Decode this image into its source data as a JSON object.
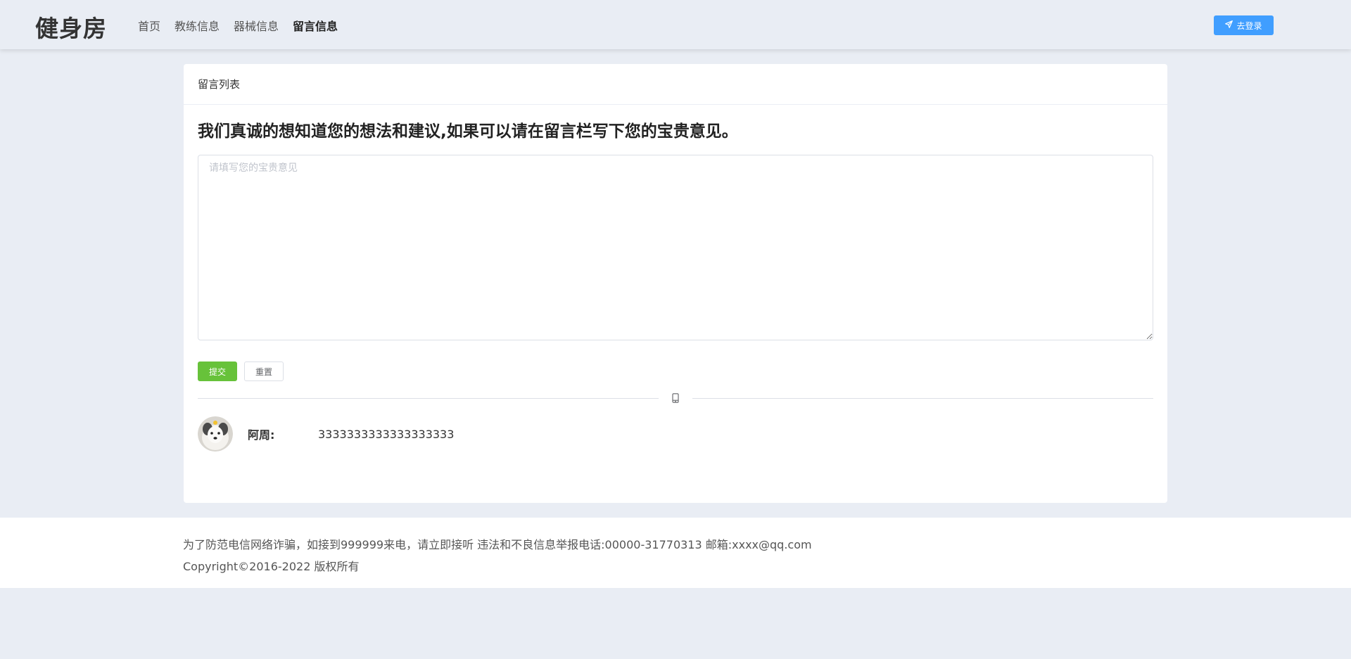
{
  "header": {
    "logo": "健身房",
    "nav": [
      {
        "label": "首页",
        "active": false
      },
      {
        "label": "教练信息",
        "active": false
      },
      {
        "label": "器械信息",
        "active": false
      },
      {
        "label": "留言信息",
        "active": true
      }
    ],
    "login_label": "去登录"
  },
  "card": {
    "title": "留言列表",
    "headline": "我们真诚的想知道您的想法和建议,如果可以请在留言栏写下您的宝贵意见。",
    "textarea": {
      "value": "",
      "placeholder": "请填写您的宝贵意见"
    },
    "submit_label": "提交",
    "reset_label": "重置",
    "comments": [
      {
        "name": "阿周:",
        "text": "3333333333333333333"
      }
    ]
  },
  "footer": {
    "line1": "为了防范电信网络诈骗，如接到999999来电，请立即接听 违法和不良信息举报电话:00000-31770313 邮箱:xxxx@qq.com",
    "line2": "Copyright©2016-2022 版权所有"
  },
  "colors": {
    "background": "#e9edf4",
    "primary": "#409eff",
    "success": "#67c23a"
  },
  "icons": {
    "login": "send-icon",
    "divider": "mobile-phone-icon"
  }
}
